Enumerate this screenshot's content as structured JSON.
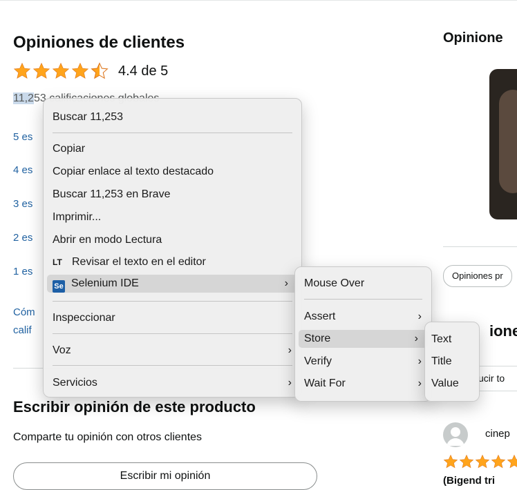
{
  "page": {
    "section_title": "Opiniones de clientes",
    "rating_text": "4.4 de 5",
    "global_count_highlight": "11,2",
    "global_count_rest": "53 calificaciones globales",
    "star_links": [
      "5 es",
      "4 es",
      "3 es",
      "2 es",
      "1 es"
    ],
    "how_calc_1": "Cóm",
    "how_calc_2": "calif",
    "write_title": "Escribir opinión de este producto",
    "share_text": "Comparte tu opinión con otros clientes",
    "write_button": "Escribir mi opinión",
    "right_title": "Opinione",
    "chip_label": "Opiniones pr",
    "right_subtitle": "ione",
    "right_filter": "ucir to",
    "reviewer": "cinep",
    "review_title": "(Bigend tri"
  },
  "menu": {
    "items": [
      {
        "label": "Buscar 11,253"
      },
      {
        "label": "Copiar"
      },
      {
        "label": "Copiar enlace al texto destacado"
      },
      {
        "label": "Buscar 11,253 en Brave"
      },
      {
        "label": "Imprimir..."
      },
      {
        "label": "Abrir en modo Lectura"
      },
      {
        "label": "Revisar el texto en el editor"
      },
      {
        "label": "Selenium IDE"
      },
      {
        "label": "Inspeccionar"
      },
      {
        "label": "Voz"
      },
      {
        "label": "Servicios"
      }
    ],
    "lt_icon_text": "LT",
    "se_icon_text": "Se"
  },
  "submenu": {
    "items": [
      {
        "label": "Mouse Over"
      },
      {
        "label": "Assert"
      },
      {
        "label": "Store"
      },
      {
        "label": "Verify"
      },
      {
        "label": "Wait For"
      }
    ]
  },
  "submenu2": {
    "items": [
      {
        "label": "Text"
      },
      {
        "label": "Title"
      },
      {
        "label": "Value"
      }
    ]
  },
  "colors": {
    "star": "#ffa41c",
    "link": "#2162a1",
    "highlight": "#c9d9ea",
    "menu_bg": "#eeeeee",
    "menu_selected": "#d6d6d6"
  },
  "icons": [
    "star-icon",
    "star-half-icon",
    "chevron-right-icon",
    "lt-icon",
    "selenium-icon",
    "avatar-icon"
  ]
}
